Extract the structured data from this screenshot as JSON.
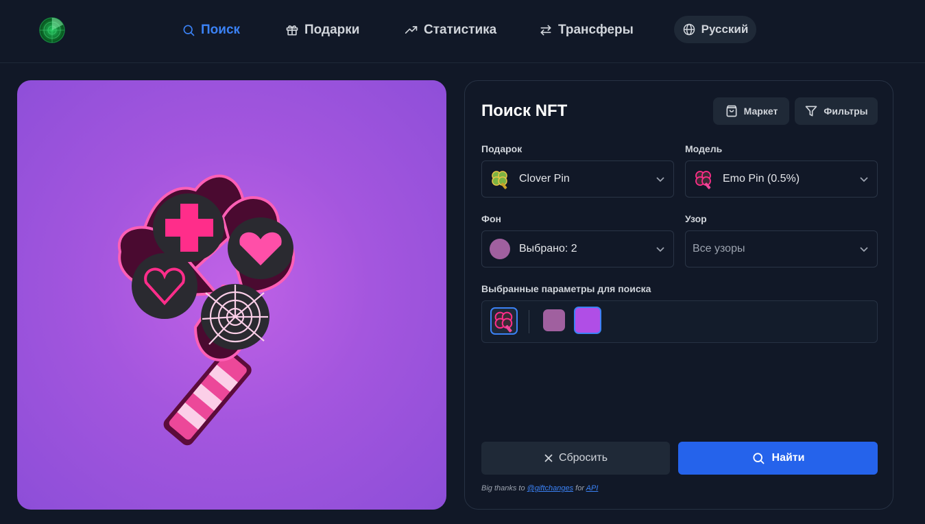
{
  "header": {
    "nav": [
      {
        "label": "Поиск",
        "icon": "search-icon",
        "active": true
      },
      {
        "label": "Подарки",
        "icon": "gift-icon"
      },
      {
        "label": "Статистика",
        "icon": "trending-up-icon"
      },
      {
        "label": "Трансферы",
        "icon": "transfer-arrows-icon"
      }
    ],
    "language": "Русский",
    "accent_color": "#3b82f6"
  },
  "panel": {
    "title": "Поиск NFT",
    "market_label": "Маркет",
    "filters_label": "Фильтры",
    "gift": {
      "label": "Подарок",
      "value": "Clover Pin"
    },
    "model": {
      "label": "Модель",
      "value": "Emo Pin (0.5%)"
    },
    "background": {
      "label": "Фон",
      "value": "Выбрано: 2"
    },
    "pattern": {
      "label": "Узор",
      "placeholder": "Все узоры"
    },
    "selected_label": "Выбранные параметры для поиска",
    "selected_chips": [
      {
        "type": "model",
        "icon": "emo-pin-icon",
        "selected": true
      },
      {
        "type": "background",
        "color": "#a0609f",
        "selected": false
      },
      {
        "type": "background",
        "color": "#b04ee6",
        "selected": true
      }
    ],
    "reset_label": "Сбросить",
    "find_label": "Найти",
    "credits": {
      "prefix": "Big thanks to",
      "handle": "@giftchanges",
      "middle": "for",
      "api": "API"
    }
  },
  "preview": {
    "background_color": "#a456de",
    "subject": "clover-pin-emo-model"
  }
}
